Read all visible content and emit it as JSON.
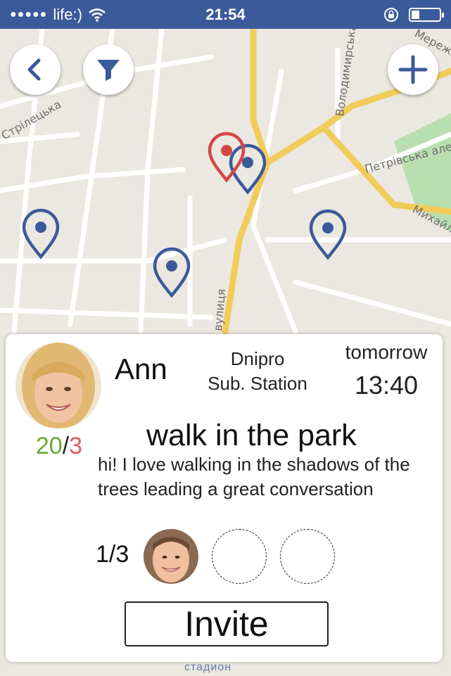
{
  "status_bar": {
    "carrier": "life:)",
    "time": "21:54",
    "battery_level_pct": 30
  },
  "map": {
    "street_labels": [
      "Володимирська",
      "Стрілецька",
      "Петрівська алея",
      "Михайлівська",
      "вулиця",
      "Мережна"
    ],
    "bottom_label": "стадион",
    "pins": [
      {
        "color": "#3b5a9a",
        "selected": false
      },
      {
        "color": "#3b5a9a",
        "selected": false
      },
      {
        "color": "#3b5a9a",
        "selected": false
      },
      {
        "color": "#3b5a9a",
        "selected": false
      },
      {
        "color": "#d64545",
        "selected": true
      }
    ]
  },
  "toolbar": {
    "back_icon": "chevron-left-icon",
    "filter_icon": "filter-icon",
    "add_icon": "plus-icon"
  },
  "event_card": {
    "host_name": "Ann",
    "location_line1": "Dnipro",
    "location_line2": "Sub. Station",
    "day": "tomorrow",
    "time": "13:40",
    "rating_positive": "20",
    "rating_separator": "/",
    "rating_negative": "3",
    "title": "walk in the park",
    "description": "hi! I love walking in the shadows of the trees leading a great conversation",
    "participants_count": "1/3",
    "invite_label": "Invite"
  },
  "colors": {
    "status_bar": "#3b5a9a",
    "pin_blue": "#3b5a9a",
    "pin_red": "#d64545",
    "rating_positive": "#6aa832",
    "rating_negative": "#e45b5b"
  }
}
